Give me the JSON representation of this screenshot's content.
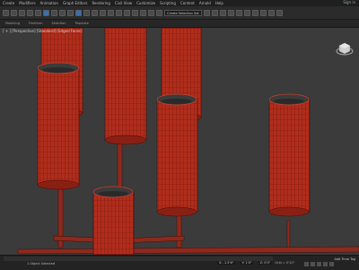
{
  "menu": [
    "Create",
    "Modifiers",
    "Animation",
    "Graph Editors",
    "Rendering",
    "Civil View",
    "Customize",
    "Scripting",
    "Content",
    "Arnold",
    "Help"
  ],
  "signin": "Sign in",
  "toolbar": {
    "selection_set": "Create Selection Set"
  },
  "ribbon": [
    "Modeling",
    "Freeform",
    "Selection",
    "Populate"
  ],
  "viewport": {
    "label": "[ + ] [Perspective] [Standard] [Edged Faces]"
  },
  "status": {
    "selection": "1 Object Selected",
    "x": "X: -1.5'6\"",
    "y": "Y: 1'0\"",
    "z": "Z: 0'0\"",
    "grid": "Grid = 0'10\"",
    "addtag": "Add Time Tag"
  },
  "colors": {
    "cylinder": "#b7301f",
    "wire": "#5a0d06",
    "stem": "#8c2a1e",
    "viewport_bg": "#3b3b3b"
  }
}
